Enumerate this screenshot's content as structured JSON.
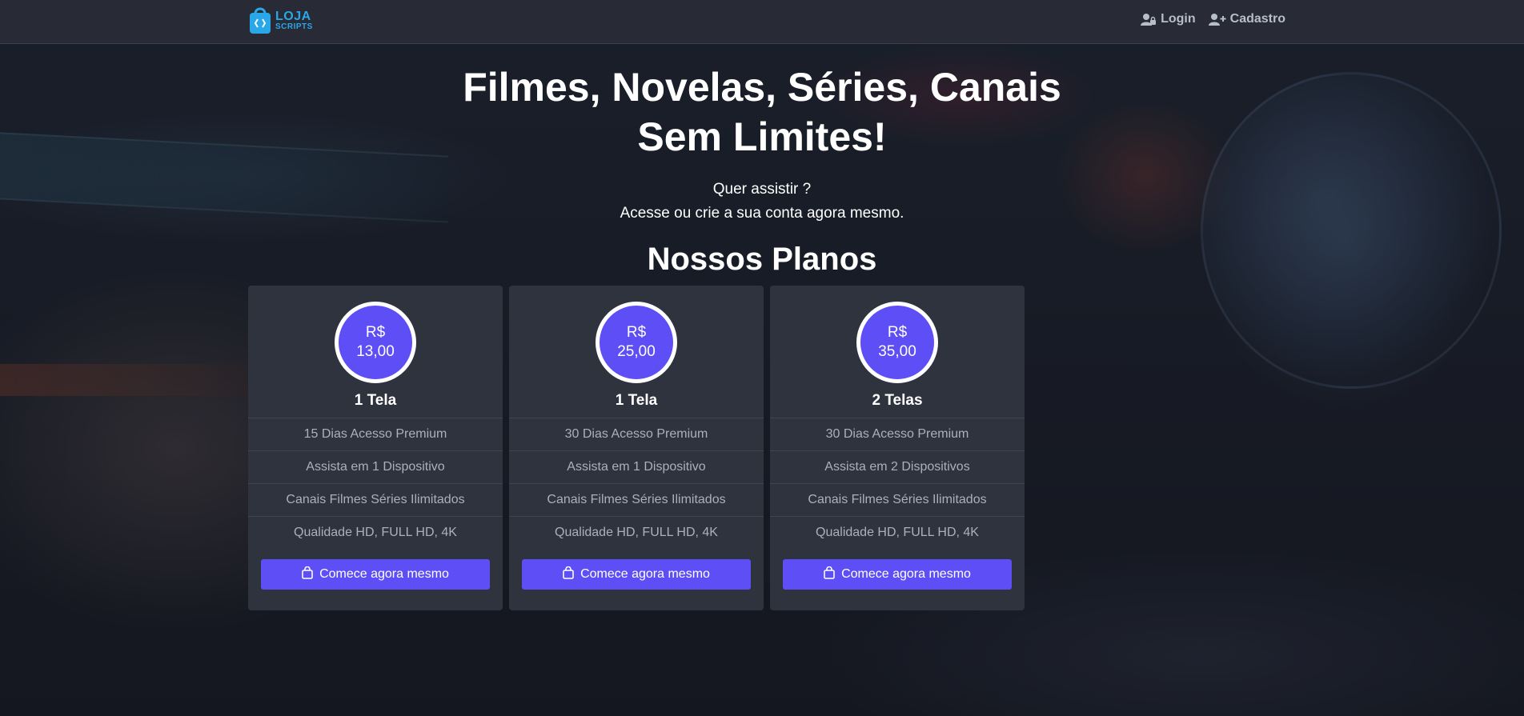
{
  "colors": {
    "accent": "#5d4ef6",
    "navbar_bg": "#282b35",
    "card_bg": "#2f333e",
    "logo_blue": "#29a7e8"
  },
  "navbar": {
    "logo": {
      "line1": "LOJA",
      "line2": "SCRIPTS",
      "icon": "shopping-bag-icon"
    },
    "links": [
      {
        "label": "Login",
        "icon": "user-lock-icon"
      },
      {
        "label": "Cadastro",
        "icon": "user-plus-icon"
      }
    ]
  },
  "hero": {
    "title_line1": "Filmes, Novelas, Séries, Canais",
    "title_line2": "Sem Limites!",
    "subtitle_line1": "Quer assistir ?",
    "subtitle_line2": "Acesse ou crie a sua conta agora mesmo."
  },
  "plans_section": {
    "title": "Nossos Planos",
    "plans": [
      {
        "currency": "R$",
        "price": "13,00",
        "name": "1 Tela",
        "features": [
          "15 Dias Acesso Premium",
          "Assista em 1 Dispositivo",
          "Canais Filmes Séries Ilimitados",
          "Qualidade HD, FULL HD, 4K"
        ],
        "cta": "Comece agora mesmo"
      },
      {
        "currency": "R$",
        "price": "25,00",
        "name": "1 Tela",
        "features": [
          "30 Dias Acesso Premium",
          "Assista em 1 Dispositivo",
          "Canais Filmes Séries Ilimitados",
          "Qualidade HD, FULL HD, 4K"
        ],
        "cta": "Comece agora mesmo"
      },
      {
        "currency": "R$",
        "price": "35,00",
        "name": "2 Telas",
        "features": [
          "30 Dias Acesso Premium",
          "Assista em 2 Dispositivos",
          "Canais Filmes Séries Ilimitados",
          "Qualidade HD, FULL HD, 4K"
        ],
        "cta": "Comece agora mesmo"
      }
    ]
  }
}
